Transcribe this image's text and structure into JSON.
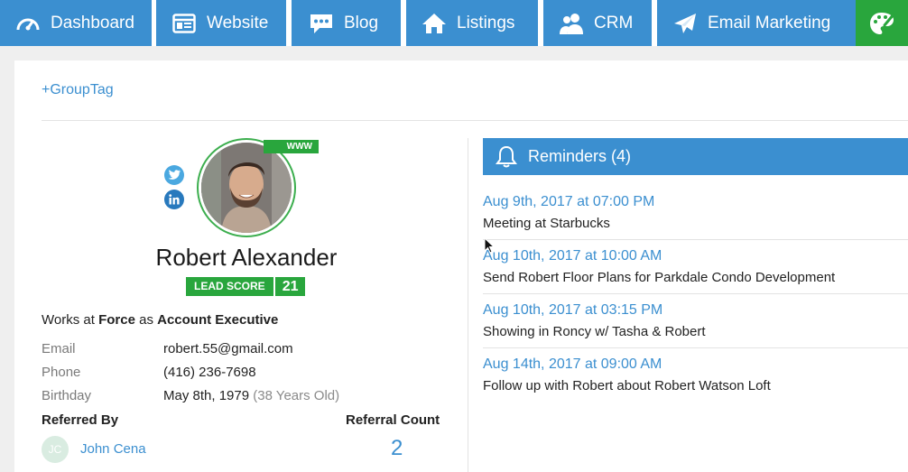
{
  "nav": {
    "items": [
      {
        "label": "Dashboard",
        "icon": "dashboard-gauge-icon"
      },
      {
        "label": "Website",
        "icon": "website-window-icon"
      },
      {
        "label": "Blog",
        "icon": "blog-speech-bubble-icon"
      },
      {
        "label": "Listings",
        "icon": "house-icon"
      },
      {
        "label": "CRM",
        "icon": "users-icon"
      },
      {
        "label": "Email Marketing",
        "icon": "paper-plane-icon"
      }
    ],
    "active_icon": "palette-icon",
    "colors": {
      "bar": "#3b8fd0",
      "active": "#29a63d"
    }
  },
  "group_tag": "+GroupTag",
  "profile": {
    "www_badge": "WWW",
    "name": "Robert Alexander",
    "lead_score_label": "LEAD SCORE",
    "lead_score_value": "21",
    "works_at_prefix": "Works at",
    "company": "Force",
    "as_word": "as",
    "title": "Account Executive",
    "fields": [
      {
        "key": "Email",
        "value": "robert.55@gmail.com",
        "extra": ""
      },
      {
        "key": "Phone",
        "value": "(416) 236-7698",
        "extra": ""
      },
      {
        "key": "Birthday",
        "value": "May 8th, 1979",
        "extra": "(38 Years Old)"
      }
    ],
    "referred_by_label": "Referred By",
    "referral_count_label": "Referral Count",
    "referrer_initials": "JC",
    "referrer_name": "John Cena",
    "referral_count": "2"
  },
  "reminders": {
    "title": "Reminders (4)",
    "items": [
      {
        "time": "Aug 9th, 2017 at 07:00 PM",
        "text": "Meeting at Starbucks"
      },
      {
        "time": "Aug 10th, 2017 at 10:00 AM",
        "text": "Send Robert Floor Plans for Parkdale Condo Development"
      },
      {
        "time": "Aug 10th, 2017 at 03:15 PM",
        "text": "Showing in Roncy w/ Tasha & Robert"
      },
      {
        "time": "Aug 14th, 2017 at 09:00 AM",
        "text": "Follow up with Robert about Robert Watson Loft"
      }
    ]
  }
}
